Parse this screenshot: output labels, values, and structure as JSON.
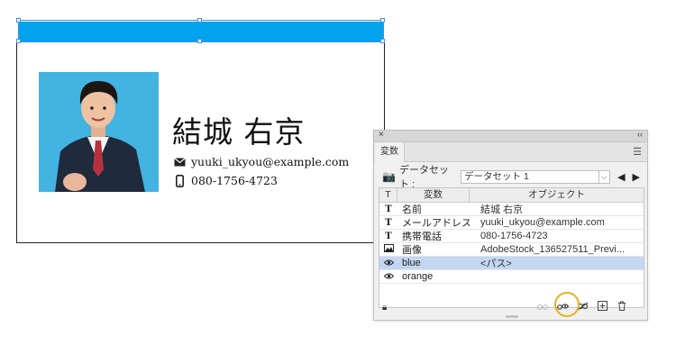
{
  "card": {
    "name": "結城 右京",
    "email": "yuuki_ukyou@example.com",
    "phone": "080-1756-4723",
    "band_color": "#00a3ec"
  },
  "panel": {
    "title_close": "×",
    "title_collapse": "‹‹",
    "tab": "変数",
    "dataset_label": "データセット :",
    "dataset_value": "データセット 1",
    "columns": {
      "type": "T",
      "variable": "変数",
      "object": "オブジェクト"
    },
    "rows": [
      {
        "type_icon": "T",
        "name": "名前",
        "object": "結城 右京"
      },
      {
        "type_icon": "T",
        "name": "メールアドレス",
        "object": "yuuki_ukyou@example.com"
      },
      {
        "type_icon": "T",
        "name": "携帯電話",
        "object": "080-1756-4723"
      },
      {
        "type_icon": "image-icon",
        "name": "画像",
        "object": "AdobeStock_136527511_Previ..."
      },
      {
        "type_icon": "eye-icon",
        "name": "blue",
        "object": "<パス>",
        "selected": true
      },
      {
        "type_icon": "eye-icon",
        "name": "orange",
        "object": ""
      }
    ],
    "selection_color": "#c3d7f2",
    "highlight_ring_color": "#e8b21a"
  }
}
